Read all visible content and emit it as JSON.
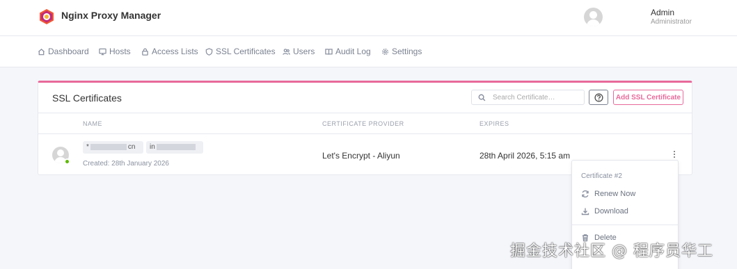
{
  "app": {
    "title": "Nginx Proxy Manager"
  },
  "user": {
    "name": "Admin",
    "role": "Administrator"
  },
  "nav": {
    "items": [
      {
        "label": "Dashboard",
        "icon": "home-icon"
      },
      {
        "label": "Hosts",
        "icon": "monitor-icon"
      },
      {
        "label": "Access Lists",
        "icon": "lock-icon"
      },
      {
        "label": "SSL Certificates",
        "icon": "shield-icon"
      },
      {
        "label": "Users",
        "icon": "users-icon"
      },
      {
        "label": "Audit Log",
        "icon": "book-icon"
      },
      {
        "label": "Settings",
        "icon": "gear-icon"
      }
    ]
  },
  "card": {
    "title": "SSL Certificates",
    "search_placeholder": "Search Certificate…",
    "add_label": "Add SSL Certificate",
    "accent": "#e8699a",
    "columns": [
      "NAME",
      "CERTIFICATE PROVIDER",
      "EXPIRES"
    ]
  },
  "certificate": {
    "domain_1_prefix": "*",
    "domain_1_suffix": "cn",
    "domain_2_prefix": "in",
    "created": "Created: 28th January 2026",
    "provider": "Let's Encrypt - Aliyun",
    "expires": "28th April 2026, 5:15 am",
    "status_color": "#5eba00"
  },
  "menu": {
    "header": "Certificate #2",
    "renew": "Renew Now",
    "download": "Download",
    "delete": "Delete"
  },
  "watermark": "掘金技术社区 @ 程序员华工"
}
